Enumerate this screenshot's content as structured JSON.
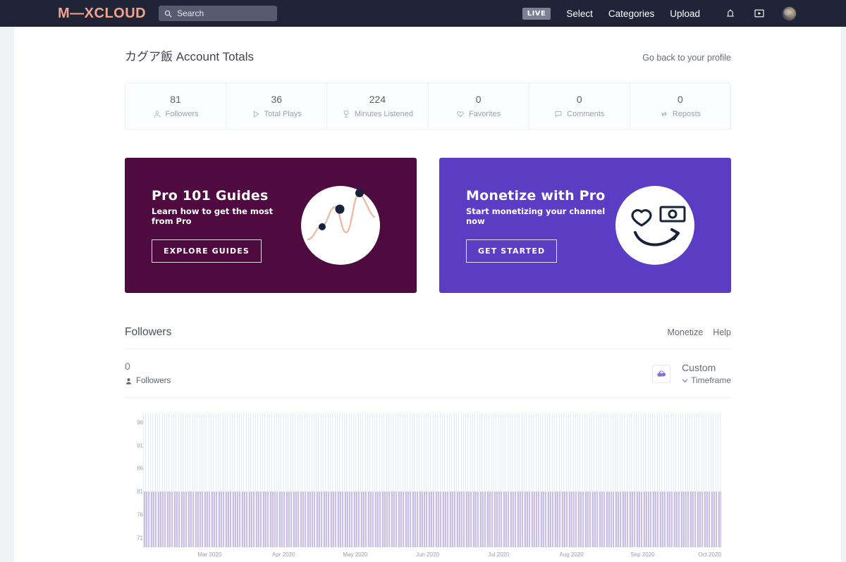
{
  "header": {
    "logo": "M—XCLOUD",
    "search_placeholder": "Search",
    "live_badge": "LIVE",
    "nav": [
      {
        "label": "Select"
      },
      {
        "label": "Categories"
      },
      {
        "label": "Upload"
      }
    ],
    "icons": {
      "notifications": "bell-icon",
      "player": "play-box-icon",
      "avatar": "user-avatar"
    }
  },
  "page": {
    "title": "カグア飯 Account Totals",
    "profile_link": "Go back to your profile"
  },
  "stats": [
    {
      "value": "81",
      "label": "Followers",
      "icon": "person-icon"
    },
    {
      "value": "36",
      "label": "Total Plays",
      "icon": "play-icon"
    },
    {
      "value": "224",
      "label": "Minutes Listened",
      "icon": "trophy-icon"
    },
    {
      "value": "0",
      "label": "Favorites",
      "icon": "heart-icon"
    },
    {
      "value": "0",
      "label": "Comments",
      "icon": "comment-icon"
    },
    {
      "value": "0",
      "label": "Reposts",
      "icon": "repost-icon"
    }
  ],
  "promos": [
    {
      "title": "Pro 101 Guides",
      "subtitle": "Learn how to get the most from Pro",
      "button": "EXPLORE GUIDES",
      "bg_color": "#4f0b40",
      "art": "line-chart-circle-illustration"
    },
    {
      "title": "Monetize with Pro",
      "subtitle": "Start monetizing your channel now",
      "button": "GET STARTED",
      "bg_color": "#5b3dc4",
      "art": "smiley-money-circle-illustration"
    }
  ],
  "followers_section": {
    "title": "Followers",
    "links": [
      {
        "label": "Monetize"
      },
      {
        "label": "Help"
      }
    ],
    "summary_value": "0",
    "summary_label": "Followers",
    "cloud_icon": "cloud-upload-icon",
    "timeframe_main": "Custom",
    "timeframe_sub": "Timeframe",
    "timeframe_chevron": "chevron-down-icon"
  },
  "chart_data": {
    "type": "bar",
    "title": "Followers",
    "xlabel": "",
    "ylabel": "Followers",
    "ylim": [
      69,
      98
    ],
    "yticks": [
      96,
      91,
      86,
      81,
      76,
      71
    ],
    "grid": false,
    "bar_color": "#a186d7",
    "plot_bg": "#fbfefe",
    "categories": [
      "Mar 2020",
      "Apr 2020",
      "May 2020",
      "Jun 2020",
      "Jul 2020",
      "Aug 2020",
      "Sep 2020",
      "Oct 2020"
    ],
    "x_tick_positions_pct": [
      11.5,
      24.3,
      36.7,
      49.2,
      61.5,
      74.1,
      86.4,
      98.0
    ],
    "series": [
      {
        "name": "Followers",
        "note": "daily values, flat at 81 across the full visible range",
        "values": [
          81,
          81,
          81,
          81,
          81,
          81,
          81,
          81,
          81,
          81,
          81,
          81,
          81,
          81,
          81,
          81,
          81,
          81,
          81,
          81,
          81,
          81,
          81,
          81,
          81,
          81,
          81,
          81,
          81,
          81,
          81,
          81,
          81,
          81,
          81,
          81,
          81,
          81,
          81,
          81,
          81,
          81,
          81,
          81,
          81,
          81,
          81,
          81,
          81,
          81,
          81,
          81,
          81,
          81,
          81,
          81,
          81,
          81,
          81,
          81,
          81,
          81,
          81,
          81,
          81,
          81,
          81,
          81,
          81,
          81,
          81,
          81,
          81,
          81,
          81,
          81,
          81,
          81,
          81,
          81,
          81,
          81,
          81,
          81,
          81,
          81,
          81,
          81,
          81,
          81,
          81,
          81,
          81,
          81,
          81,
          81,
          81,
          81,
          81,
          81,
          81,
          81,
          81,
          81,
          81,
          81,
          81,
          81,
          81,
          81,
          81,
          81,
          81,
          81,
          81,
          81,
          81,
          81,
          81,
          81,
          81,
          81,
          81,
          81,
          81,
          81,
          81,
          81,
          81,
          81,
          81,
          81,
          81,
          81,
          81,
          81,
          81,
          81,
          81,
          81,
          81,
          81,
          81,
          81,
          81,
          81,
          81,
          81,
          81,
          81,
          81,
          81,
          81,
          81,
          81,
          81,
          81,
          81,
          81,
          81,
          81,
          81,
          81,
          81,
          81,
          81,
          81,
          81,
          81,
          81,
          81,
          81,
          81,
          81,
          81,
          81,
          81,
          81,
          81,
          81,
          81,
          81,
          81,
          81,
          81,
          81,
          81,
          81,
          81,
          81,
          81,
          81,
          81,
          81,
          81,
          81,
          81,
          81,
          81,
          81,
          81,
          81,
          81,
          81,
          81,
          81,
          81,
          81,
          81,
          81,
          81,
          81,
          81,
          81,
          81,
          81,
          81,
          81,
          81,
          81,
          81,
          81,
          81,
          81,
          81,
          81,
          81,
          81,
          81,
          81,
          81,
          81,
          81,
          81,
          81,
          81,
          81,
          81,
          81,
          81,
          81,
          81,
          81,
          81,
          81,
          81,
          81,
          81
        ]
      }
    ]
  }
}
